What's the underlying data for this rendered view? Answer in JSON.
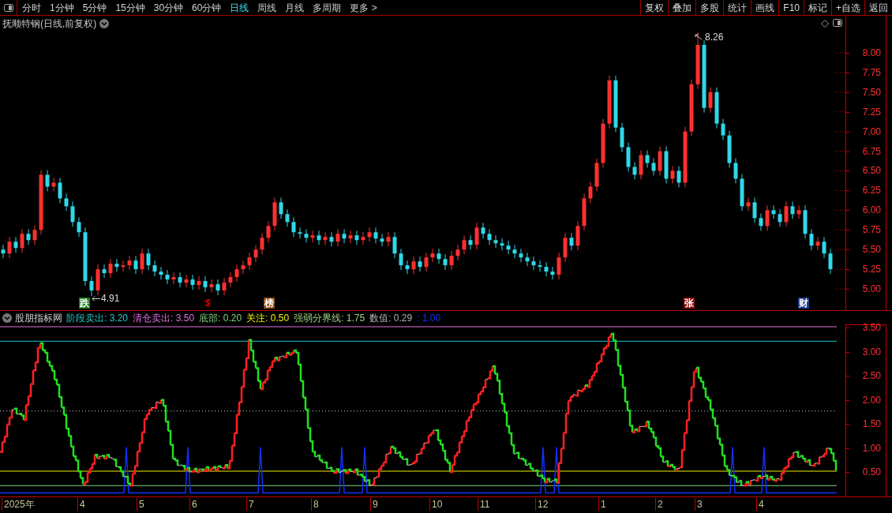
{
  "toolbar": {
    "tabs": [
      {
        "label": "分时",
        "selected": false
      },
      {
        "label": "1分钟",
        "selected": false
      },
      {
        "label": "5分钟",
        "selected": false
      },
      {
        "label": "15分钟",
        "selected": false
      },
      {
        "label": "30分钟",
        "selected": false
      },
      {
        "label": "60分钟",
        "selected": false
      },
      {
        "label": "日线",
        "selected": true
      },
      {
        "label": "周线",
        "selected": false
      },
      {
        "label": "月线",
        "selected": false
      },
      {
        "label": "多周期",
        "selected": false
      },
      {
        "label": "更多 >",
        "selected": false
      }
    ],
    "buttons": [
      "复权",
      "叠加",
      "多股",
      "统计",
      "画线",
      "F10",
      "标记",
      "+自选",
      "返回"
    ]
  },
  "price_chart": {
    "title": "抚顺特钢(日线,前复权)",
    "chart_data": {
      "type": "candlestick",
      "ylim": [
        4.73,
        8.47
      ],
      "yticks": [
        {
          "value": 8,
          "label": "8.00"
        },
        {
          "value": 7.75,
          "label": "7.75"
        },
        {
          "value": 7.5,
          "label": "7.50"
        },
        {
          "value": 7.25,
          "label": "7.25"
        },
        {
          "value": 7,
          "label": "7.00"
        },
        {
          "value": 6.75,
          "label": "6.75"
        },
        {
          "value": 6.5,
          "label": "6.50"
        },
        {
          "value": 6.25,
          "label": "6.25"
        },
        {
          "value": 6,
          "label": "6.00"
        },
        {
          "value": 5.75,
          "label": "5.75"
        },
        {
          "value": 5.5,
          "label": "5.50"
        },
        {
          "value": 5.25,
          "label": "5.25"
        },
        {
          "value": 5,
          "label": "5.00"
        }
      ],
      "ohlc": [
        [
          5.5,
          5.56,
          5.39,
          5.45
        ],
        [
          5.45,
          5.66,
          5.39,
          5.6
        ],
        [
          5.6,
          5.66,
          5.46,
          5.52
        ],
        [
          5.52,
          5.76,
          5.46,
          5.7
        ],
        [
          5.7,
          5.76,
          5.56,
          5.62
        ],
        [
          5.62,
          5.81,
          5.56,
          5.75
        ],
        [
          5.75,
          6.51,
          5.69,
          6.45
        ],
        [
          6.45,
          6.51,
          6.24,
          6.3
        ],
        [
          6.3,
          6.41,
          6.24,
          6.35
        ],
        [
          6.35,
          6.41,
          6.09,
          6.15
        ],
        [
          6.15,
          6.21,
          5.99,
          6.05
        ],
        [
          6.05,
          6.11,
          5.79,
          5.85
        ],
        [
          5.85,
          5.91,
          5.66,
          5.72
        ],
        [
          5.72,
          5.78,
          5.04,
          5.1
        ],
        [
          5.1,
          5.16,
          4.91,
          4.98
        ],
        [
          4.98,
          5.31,
          4.92,
          5.25
        ],
        [
          5.25,
          5.31,
          5.14,
          5.2
        ],
        [
          5.2,
          5.38,
          5.14,
          5.32
        ],
        [
          5.32,
          5.38,
          5.22,
          5.28
        ],
        [
          5.28,
          5.36,
          5.22,
          5.3
        ],
        [
          5.3,
          5.42,
          5.24,
          5.36
        ],
        [
          5.36,
          5.42,
          5.19,
          5.25
        ],
        [
          5.25,
          5.51,
          5.19,
          5.45
        ],
        [
          5.45,
          5.51,
          5.24,
          5.3
        ],
        [
          5.3,
          5.36,
          5.16,
          5.22
        ],
        [
          5.22,
          5.28,
          5.12,
          5.18
        ],
        [
          5.18,
          5.24,
          5.06,
          5.12
        ],
        [
          5.12,
          5.21,
          5.06,
          5.15
        ],
        [
          5.15,
          5.21,
          5.02,
          5.08
        ],
        [
          5.08,
          5.18,
          5.02,
          5.12
        ],
        [
          5.12,
          5.18,
          4.99,
          5.05
        ],
        [
          5.05,
          5.16,
          4.99,
          5.1
        ],
        [
          5.1,
          5.16,
          4.96,
          5.02
        ],
        [
          5.02,
          5.12,
          4.96,
          5.06
        ],
        [
          5.06,
          5.12,
          4.92,
          4.98
        ],
        [
          4.98,
          5.14,
          4.92,
          5.08
        ],
        [
          5.08,
          5.21,
          5.02,
          5.15
        ],
        [
          5.15,
          5.31,
          5.09,
          5.25
        ],
        [
          5.25,
          5.36,
          5.19,
          5.3
        ],
        [
          5.3,
          5.46,
          5.24,
          5.4
        ],
        [
          5.4,
          5.56,
          5.34,
          5.5
        ],
        [
          5.5,
          5.71,
          5.44,
          5.65
        ],
        [
          5.65,
          5.86,
          5.59,
          5.8
        ],
        [
          5.8,
          6.16,
          5.74,
          6.1
        ],
        [
          6.1,
          6.16,
          5.89,
          5.95
        ],
        [
          5.95,
          6.01,
          5.79,
          5.85
        ],
        [
          5.85,
          5.91,
          5.66,
          5.72
        ],
        [
          5.72,
          5.78,
          5.64,
          5.7
        ],
        [
          5.7,
          5.76,
          5.59,
          5.65
        ],
        [
          5.65,
          5.74,
          5.59,
          5.68
        ],
        [
          5.68,
          5.74,
          5.56,
          5.62
        ],
        [
          5.62,
          5.72,
          5.56,
          5.66
        ],
        [
          5.66,
          5.72,
          5.54,
          5.6
        ],
        [
          5.6,
          5.76,
          5.54,
          5.7
        ],
        [
          5.7,
          5.76,
          5.58,
          5.64
        ],
        [
          5.64,
          5.74,
          5.58,
          5.68
        ],
        [
          5.68,
          5.74,
          5.56,
          5.62
        ],
        [
          5.62,
          5.72,
          5.56,
          5.66
        ],
        [
          5.66,
          5.78,
          5.6,
          5.72
        ],
        [
          5.72,
          5.78,
          5.58,
          5.64
        ],
        [
          5.64,
          5.7,
          5.54,
          5.6
        ],
        [
          5.6,
          5.72,
          5.54,
          5.66
        ],
        [
          5.66,
          5.72,
          5.39,
          5.45
        ],
        [
          5.45,
          5.51,
          5.24,
          5.3
        ],
        [
          5.3,
          5.36,
          5.19,
          5.25
        ],
        [
          5.25,
          5.41,
          5.19,
          5.35
        ],
        [
          5.35,
          5.41,
          5.22,
          5.28
        ],
        [
          5.28,
          5.46,
          5.22,
          5.4
        ],
        [
          5.4,
          5.51,
          5.34,
          5.45
        ],
        [
          5.45,
          5.51,
          5.32,
          5.38
        ],
        [
          5.38,
          5.44,
          5.24,
          5.3
        ],
        [
          5.3,
          5.48,
          5.24,
          5.42
        ],
        [
          5.42,
          5.56,
          5.36,
          5.5
        ],
        [
          5.5,
          5.68,
          5.44,
          5.62
        ],
        [
          5.62,
          5.68,
          5.5,
          5.56
        ],
        [
          5.56,
          5.84,
          5.5,
          5.78
        ],
        [
          5.78,
          5.84,
          5.64,
          5.7
        ],
        [
          5.7,
          5.76,
          5.56,
          5.62
        ],
        [
          5.62,
          5.68,
          5.52,
          5.58
        ],
        [
          5.58,
          5.64,
          5.49,
          5.55
        ],
        [
          5.55,
          5.61,
          5.44,
          5.5
        ],
        [
          5.5,
          5.56,
          5.39,
          5.45
        ],
        [
          5.45,
          5.51,
          5.34,
          5.4
        ],
        [
          5.4,
          5.46,
          5.29,
          5.35
        ],
        [
          5.35,
          5.41,
          5.24,
          5.3
        ],
        [
          5.3,
          5.36,
          5.22,
          5.28
        ],
        [
          5.28,
          5.34,
          5.16,
          5.22
        ],
        [
          5.22,
          5.28,
          5.12,
          5.18
        ],
        [
          5.18,
          5.46,
          5.12,
          5.4
        ],
        [
          5.4,
          5.71,
          5.34,
          5.65
        ],
        [
          5.65,
          5.71,
          5.49,
          5.55
        ],
        [
          5.55,
          5.86,
          5.49,
          5.8
        ],
        [
          5.8,
          6.21,
          5.74,
          6.15
        ],
        [
          6.15,
          6.36,
          6.09,
          6.3
        ],
        [
          6.3,
          6.66,
          6.24,
          6.6
        ],
        [
          6.6,
          7.16,
          6.54,
          7.1
        ],
        [
          7.1,
          7.71,
          7.04,
          7.65
        ],
        [
          7.65,
          7.71,
          6.99,
          7.05
        ],
        [
          7.05,
          7.11,
          6.74,
          6.8
        ],
        [
          6.8,
          6.86,
          6.49,
          6.55
        ],
        [
          6.55,
          6.61,
          6.39,
          6.45
        ],
        [
          6.45,
          6.76,
          6.39,
          6.7
        ],
        [
          6.7,
          6.76,
          6.54,
          6.6
        ],
        [
          6.6,
          6.66,
          6.44,
          6.5
        ],
        [
          6.5,
          6.81,
          6.44,
          6.75
        ],
        [
          6.75,
          6.81,
          6.34,
          6.4
        ],
        [
          6.4,
          6.56,
          6.34,
          6.5
        ],
        [
          6.5,
          6.56,
          6.29,
          6.35
        ],
        [
          6.35,
          7.06,
          6.29,
          7.0
        ],
        [
          7.0,
          7.66,
          6.94,
          7.6
        ],
        [
          7.6,
          8.26,
          7.54,
          8.1
        ],
        [
          8.1,
          8.16,
          7.24,
          7.3
        ],
        [
          7.3,
          7.56,
          7.24,
          7.5
        ],
        [
          7.5,
          7.56,
          7.04,
          7.1
        ],
        [
          7.1,
          7.16,
          6.89,
          6.95
        ],
        [
          6.95,
          7.01,
          6.54,
          6.6
        ],
        [
          6.6,
          6.66,
          6.34,
          6.4
        ],
        [
          6.4,
          6.46,
          5.99,
          6.05
        ],
        [
          6.05,
          6.16,
          5.99,
          6.1
        ],
        [
          6.1,
          6.16,
          5.84,
          5.9
        ],
        [
          5.9,
          5.96,
          5.74,
          5.8
        ],
        [
          5.8,
          6.06,
          5.74,
          6.0
        ],
        [
          6.0,
          6.06,
          5.89,
          5.95
        ],
        [
          5.95,
          6.01,
          5.79,
          5.85
        ],
        [
          5.85,
          6.11,
          5.79,
          6.05
        ],
        [
          6.05,
          6.11,
          5.89,
          5.95
        ],
        [
          5.95,
          6.06,
          5.89,
          6.0
        ],
        [
          6.0,
          6.06,
          5.64,
          5.7
        ],
        [
          5.7,
          5.76,
          5.49,
          5.55
        ],
        [
          5.55,
          5.66,
          5.49,
          5.6
        ],
        [
          5.6,
          5.66,
          5.39,
          5.45
        ],
        [
          5.45,
          5.51,
          5.19,
          5.25
        ]
      ]
    },
    "high_label": "8.26",
    "low_label": "4.91",
    "markers": [
      {
        "text": "跌",
        "kind": "box",
        "color": "#1a7a1a"
      },
      {
        "text": "$",
        "kind": "plain",
        "color": "#e00000"
      },
      {
        "text": "榜",
        "kind": "box",
        "color": "#8a4a10"
      },
      {
        "text": "张",
        "kind": "box",
        "color": "#8a0a0a"
      },
      {
        "text": "财",
        "kind": "box",
        "color": "#1a3a8a"
      }
    ]
  },
  "indicator": {
    "name": "股朋指标网",
    "legend": [
      {
        "text": "阶段卖出: 3.20",
        "color": "#20c8c8"
      },
      {
        "text": "清仓卖出: 3.50",
        "color": "#e070e0"
      },
      {
        "text": "底部: 0.20",
        "color": "#80d080"
      },
      {
        "text": "关注: 0.50",
        "color": "#f0f000"
      },
      {
        "text": "强弱分界线: 1.75",
        "color": "#a0d080"
      },
      {
        "text": "数值: 0.29",
        "color": "#b0b0b0"
      },
      {
        "text": ": 1.00",
        "color": "#1030ff"
      }
    ],
    "axis_labels": [
      "3.50",
      "3.00",
      "2.50",
      "2.00",
      "1.50",
      "1.00",
      "0.50"
    ]
  },
  "time_axis": [
    "2025年",
    "4",
    "5",
    "6",
    "7",
    "8",
    "9",
    "10",
    "11",
    "12",
    "1",
    "2",
    "3",
    "4"
  ]
}
